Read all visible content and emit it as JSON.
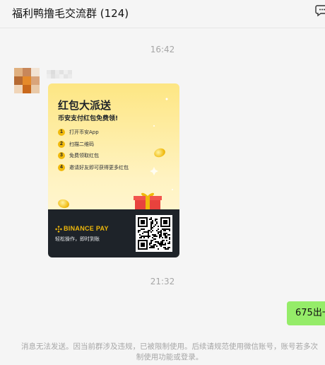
{
  "header": {
    "chat_title": "福利鸭撸毛交流群 (124)"
  },
  "messages": {
    "time_1": "16:42",
    "time_2": "21:32",
    "my_message": "675出一"
  },
  "card": {
    "title": "红包大派送",
    "subtitle": "币安支付红包免费领!",
    "steps": [
      {
        "num": "1",
        "text": "打开币安App"
      },
      {
        "num": "2",
        "text": "扫描二维码"
      },
      {
        "num": "3",
        "text": "免费领取红包"
      },
      {
        "num": "4",
        "text": "邀请好友即可获得更多红包"
      }
    ],
    "brand": "BINANCE PAY",
    "tagline": "轻松操作，即时到账",
    "accent_color": "#f0b90b",
    "dark_color": "#1e2329"
  },
  "notice": {
    "line_1": "消息无法发送。因当前群涉及违规，已被限制使用。后续请规范使用微信账号，账号若多次",
    "line_2": "制使用功能或登录。"
  },
  "colors": {
    "background": "#f5f5f5",
    "my_bubble": "#95ec69",
    "timestamp": "#a6a6a6"
  }
}
